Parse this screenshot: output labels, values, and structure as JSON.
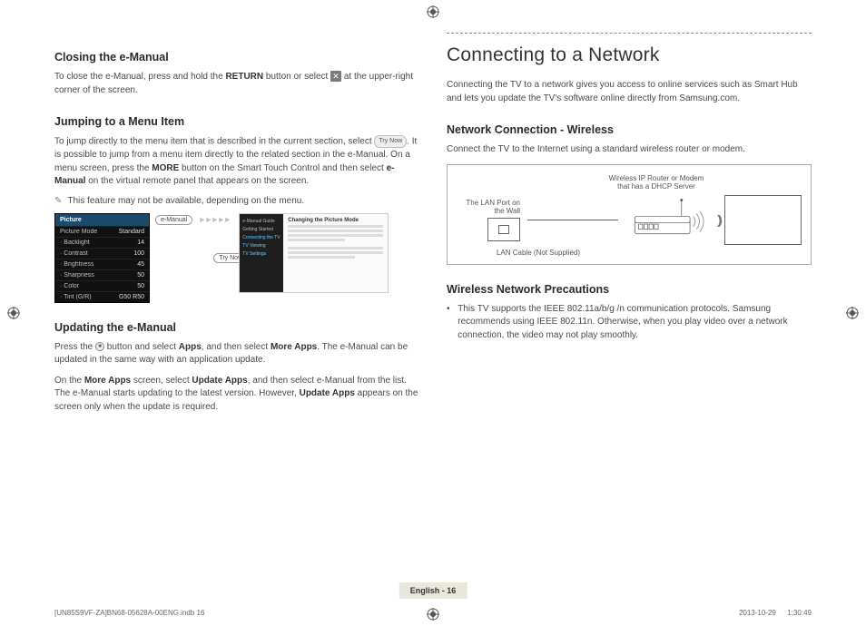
{
  "left": {
    "closing": {
      "heading": "Closing the e-Manual",
      "p1_a": "To close the e-Manual, press and hold the ",
      "p1_b": "RETURN",
      "p1_c": " button or select ",
      "p1_d": " at the upper-right corner of the screen."
    },
    "jumping": {
      "heading": "Jumping to a Menu Item",
      "p1_a": "To jump directly to the menu item that is described in the current section, select ",
      "trynow": "Try Now",
      "p1_b": ". It is possible to jump from a menu item directly to the related section in the e-Manual. On a menu screen, press the ",
      "p1_c": "MORE",
      "p1_d": " button on the Smart Touch Control and then select ",
      "p1_e": "e-Manual",
      "p1_f": " on the virtual remote panel that appears on the screen.",
      "note": "This feature may not be available, depending on the menu."
    },
    "picmenu": {
      "title": "Picture",
      "moderow": {
        "k": "Picture Mode",
        "v": "Standard"
      },
      "rows": [
        {
          "k": "· Backlight",
          "v": "14"
        },
        {
          "k": "· Contrast",
          "v": "100"
        },
        {
          "k": "· Brightness",
          "v": "45"
        },
        {
          "k": "· Sharpness",
          "v": "50"
        },
        {
          "k": "· Color",
          "v": "50"
        },
        {
          "k": "· Tint (G/R)",
          "v": "G50      R50"
        }
      ],
      "emanual_pill": "e-Manual",
      "trynow_pill": "Try Now",
      "eman_side": [
        "e-Manual Guide",
        "Getting Started",
        "Connecting the TV",
        "TV Viewing",
        "TV Settings"
      ],
      "eman_title": "Changing the Picture Mode"
    },
    "updating": {
      "heading": "Updating the e-Manual",
      "p1_a": "Press the ",
      "p1_b": " button and select ",
      "p1_c": "Apps",
      "p1_d": ", and then select ",
      "p1_e": "More Apps",
      "p1_f": ". The e-Manual can be updated in the same way with an application update.",
      "p2_a": "On the ",
      "p2_b": "More Apps",
      "p2_c": " screen, select ",
      "p2_d": "Update Apps",
      "p2_e": ", and then select e-Manual from the list. The e-Manual starts updating to the latest version. However, ",
      "p2_f": "Update Apps",
      "p2_g": " appears on the screen only when the update is required."
    }
  },
  "right": {
    "title": "Connecting to a Network",
    "intro": "Connecting the TV to a network gives you access to online services such as Smart Hub and lets you update the TV's software online directly from Samsung.com.",
    "wireless": {
      "heading": "Network Connection - Wireless",
      "p": "Connect the TV to the Internet using a standard wireless router or modem.",
      "labels": {
        "router": "Wireless IP Router or Modem\nthat has a DHCP Server",
        "wall": "The LAN Port on the Wall",
        "cable": "LAN Cable (Not Supplied)"
      }
    },
    "precautions": {
      "heading": "Wireless Network Precautions",
      "b1": "This TV supports the IEEE 802.11a/b/g /n communication protocols. Samsung recommends using IEEE 802.11n. Otherwise, when you play video over a network connection, the video may not play smoothly."
    }
  },
  "footer": {
    "page_label": "English - 16",
    "indb": "[UN85S9VF-ZA]BN68-05628A-00ENG.indb   16",
    "date": "2013-10-29      1:30:49"
  }
}
